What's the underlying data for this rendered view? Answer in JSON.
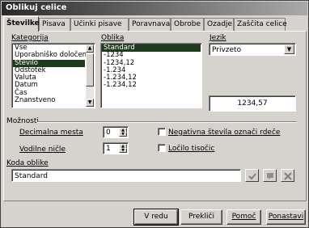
{
  "window": {
    "title": "Oblikuj celice"
  },
  "tabs": [
    {
      "label": "Številke"
    },
    {
      "label": "Pisava"
    },
    {
      "label": "Učinki pisave"
    },
    {
      "label": "Poravnava"
    },
    {
      "label": "Obrobe"
    },
    {
      "label": "Ozadje"
    },
    {
      "label": "Zaščita celice"
    }
  ],
  "category": {
    "label": "Kategorija",
    "items": [
      "Vse",
      "Uporabniško določeno",
      "Število",
      "Odstotek",
      "Valuta",
      "Datum",
      "Čas",
      "Znanstveno"
    ],
    "selected": "Število"
  },
  "format": {
    "label": "Oblika",
    "items": [
      "Standard",
      "-1234",
      "-1234,12",
      "-1.234",
      "-1.234,12",
      "-1.234,12"
    ],
    "selected": "Standard"
  },
  "language": {
    "label": "Jezik",
    "value": "Privzeto"
  },
  "preview": {
    "value": "1234,57"
  },
  "options": {
    "section_label": "Možnosti",
    "decimal_label": "Decimalna mesta",
    "decimal_value": "0",
    "leading_zeros_label": "Vodilne ničle",
    "leading_zeros_value": "1",
    "negative_red_label": "Negativna števila označi rdeče",
    "negative_red_checked": false,
    "thousands_sep_label": "Ločilo tisočic",
    "thousands_sep_checked": false
  },
  "format_code": {
    "label": "Koda oblike",
    "value": "Standard",
    "icons": [
      "check-icon",
      "comment-icon",
      "delete-icon"
    ]
  },
  "buttons": {
    "ok": "V redu",
    "cancel": "Prekliči",
    "help": "Pomoč",
    "reset": "Ponastavi"
  }
}
